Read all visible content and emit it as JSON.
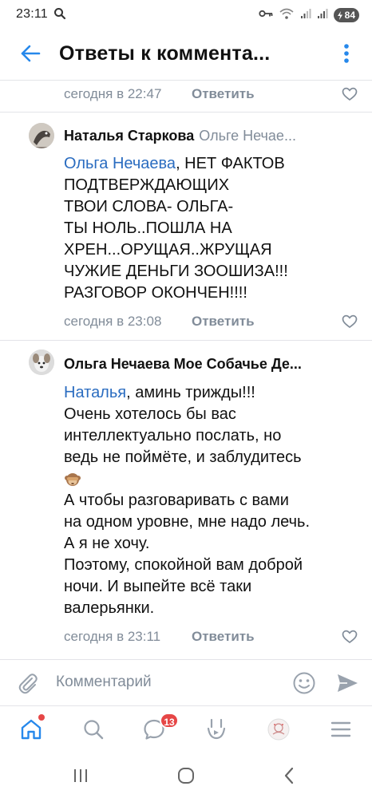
{
  "status_bar": {
    "time": "23:11",
    "battery": "84",
    "icons": [
      "search-icon",
      "key-icon",
      "wifi-icon",
      "signal-icon",
      "signal-icon",
      "battery-icon"
    ]
  },
  "header": {
    "title": "Ответы к коммента...",
    "back_icon": "arrow-left-icon",
    "menu_icon": "more-vertical-icon"
  },
  "comments": [
    {
      "date": "сегодня в 22:47",
      "reply_label": "Ответить"
    },
    {
      "author": "Наталья Старкова",
      "reply_to": "Ольге Нечае...",
      "mention": "Ольга Нечаева",
      "text_lines": [
        ", НЕТ ФАКТОВ",
        "ПОДТВЕРЖДАЮЩИХ",
        "ТВОИ СЛОВА- ОЛЬГА-",
        "ТЫ НОЛЬ..ПОШЛА НА",
        "ХРЕН...ОРУЩАЯ..ЖРУЩАЯ",
        "ЧУЖИЕ ДЕНЬГИ ЗООШИЗА!!!",
        "РАЗГОВОР ОКОНЧЕН!!!!"
      ],
      "date": "сегодня в 23:08",
      "reply_label": "Ответить"
    },
    {
      "author": "Ольга Нечаева Мое Собачье Де...",
      "mention": "Наталья",
      "text_lines": [
        ",  аминь трижды!!!",
        "Очень хотелось бы вас",
        "интеллектуально послать, но",
        "ведь не поймёте, и заблудитесь",
        "",
        "А чтобы разговаривать  с вами",
        "на одном уровне, мне надо лечь.",
        "А я не хочу.",
        "Поэтому, спокойной вам доброй",
        "ночи.  И выпейте  всё  таки",
        "валерьянки."
      ],
      "emoji_icon": "see-no-evil-monkey-icon",
      "date": "сегодня в 23:11",
      "reply_label": "Ответить"
    }
  ],
  "composer": {
    "placeholder": "Комментарий",
    "attach_icon": "paperclip-icon",
    "emoji_icon": "smiley-icon",
    "send_icon": "send-icon"
  },
  "bottom_nav": {
    "items": [
      "home-icon",
      "search-icon",
      "messages-icon",
      "clips-icon",
      "profile-avatar",
      "menu-icon"
    ],
    "messages_badge": "13"
  },
  "system_nav": [
    "recents-icon",
    "home-circle-icon",
    "back-chevron-icon"
  ],
  "colors": {
    "accent": "#2a6cc0",
    "secondary_text": "#818c99",
    "badge": "#e64646",
    "nav_icon": "#2688eb"
  }
}
